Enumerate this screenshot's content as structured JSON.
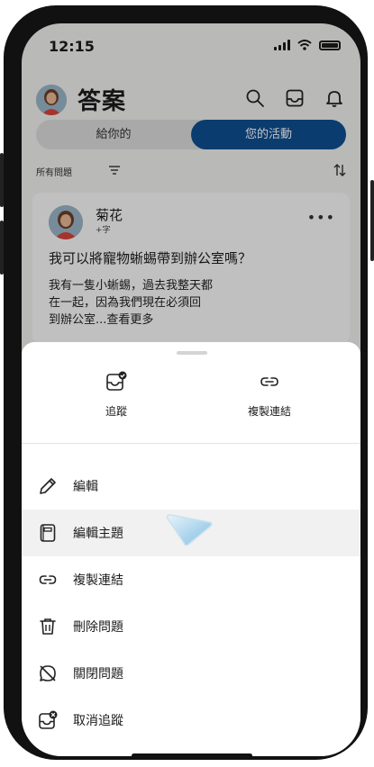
{
  "status_bar": {
    "time": "12:15"
  },
  "header": {
    "title": "答案"
  },
  "tabs": [
    {
      "label": "給你的",
      "selected": false
    },
    {
      "label": "您的活動",
      "selected": true
    }
  ],
  "filter": {
    "label": "所有問題"
  },
  "card": {
    "author": "菊花",
    "meta": "+字",
    "question": "我可以將寵物蜥蜴帶到辦公室嗎？",
    "body_lines": [
      "我有一隻小蜥蜴，過去我整天都",
      "在一起，因為我們現在必須回",
      "到辦公室"
    ],
    "ellipsis": "...",
    "see_more": "查看更多"
  },
  "sheet": {
    "quick_actions": [
      {
        "label": "追蹤",
        "icon": "inbox-check-icon"
      },
      {
        "label": "複製連結",
        "icon": "link-icon"
      }
    ],
    "items": [
      {
        "label": "編輯",
        "icon": "pencil-icon"
      },
      {
        "label": "編輯主題",
        "icon": "notebook-icon",
        "highlighted": true
      },
      {
        "label": "複製連結",
        "icon": "link-icon"
      },
      {
        "label": "刪除問題",
        "icon": "trash-icon"
      },
      {
        "label": "關閉問題",
        "icon": "chat-off-icon"
      },
      {
        "label": "取消追蹤",
        "icon": "inbox-x-icon"
      }
    ]
  },
  "colors": {
    "accent": "#0f4f91",
    "overlay": "rgba(0,0,0,0.23)",
    "sheet_bg": "#ffffff",
    "highlight": "#f1f1f1"
  }
}
